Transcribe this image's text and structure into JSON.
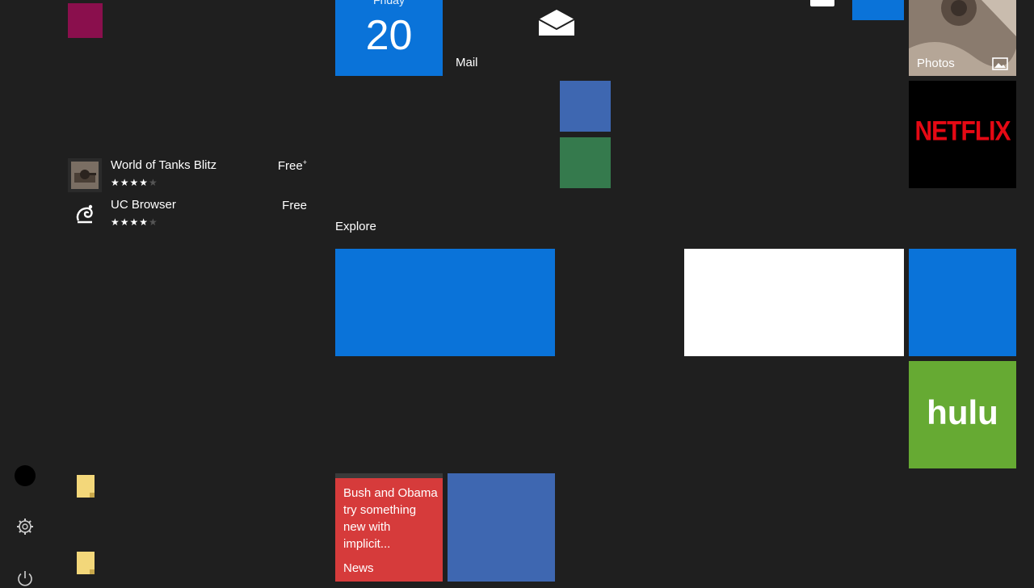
{
  "apps": [
    {
      "name": "World of Tanks Blitz",
      "price": "Free",
      "price_mark": "+",
      "rating": 4,
      "rating_max": 5,
      "icon": "tank-icon"
    },
    {
      "name": "UC Browser",
      "price": "Free",
      "price_mark": "",
      "rating": 4,
      "rating_max": 5,
      "icon": "squirrel-icon"
    }
  ],
  "tiles": {
    "calendar": {
      "day": "Friday",
      "date": "20"
    },
    "mail": {
      "label": "Mail",
      "icon": "mail-icon"
    },
    "photos": {
      "label": "Photos",
      "icon": "image-icon"
    },
    "netflix": {
      "logo": "NETFLIX"
    },
    "hulu": {
      "logo": "hulu"
    },
    "news": {
      "headline": "Bush and Obama try something new with implicit...",
      "label": "News"
    }
  },
  "sections": {
    "explore": "Explore"
  },
  "colors": {
    "background": "#1f1f1f",
    "accent_blue": "#0a73d9",
    "netflix_red": "#e50914",
    "hulu_green": "#66aa33",
    "news_red": "#d63b3b"
  },
  "rail": {
    "icons": [
      "user-avatar-icon",
      "gear-icon",
      "power-icon"
    ]
  }
}
